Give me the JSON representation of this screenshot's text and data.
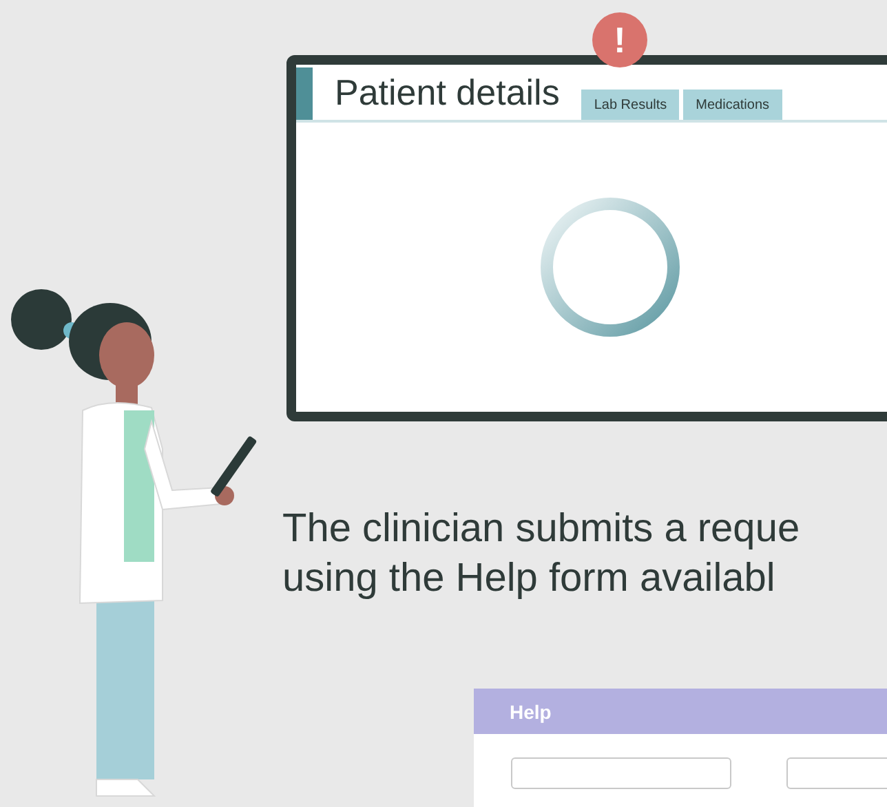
{
  "monitor": {
    "tabs": [
      {
        "label": "Patient details",
        "selected": true
      },
      {
        "label": "Lab Results",
        "selected": false
      },
      {
        "label": "Medications",
        "selected": false
      }
    ],
    "alert": {
      "symbol": "!"
    }
  },
  "caption": {
    "lines": [
      "The clinician submits a reque",
      "using the Help form availabl"
    ]
  },
  "help_form": {
    "title": "Help"
  }
}
